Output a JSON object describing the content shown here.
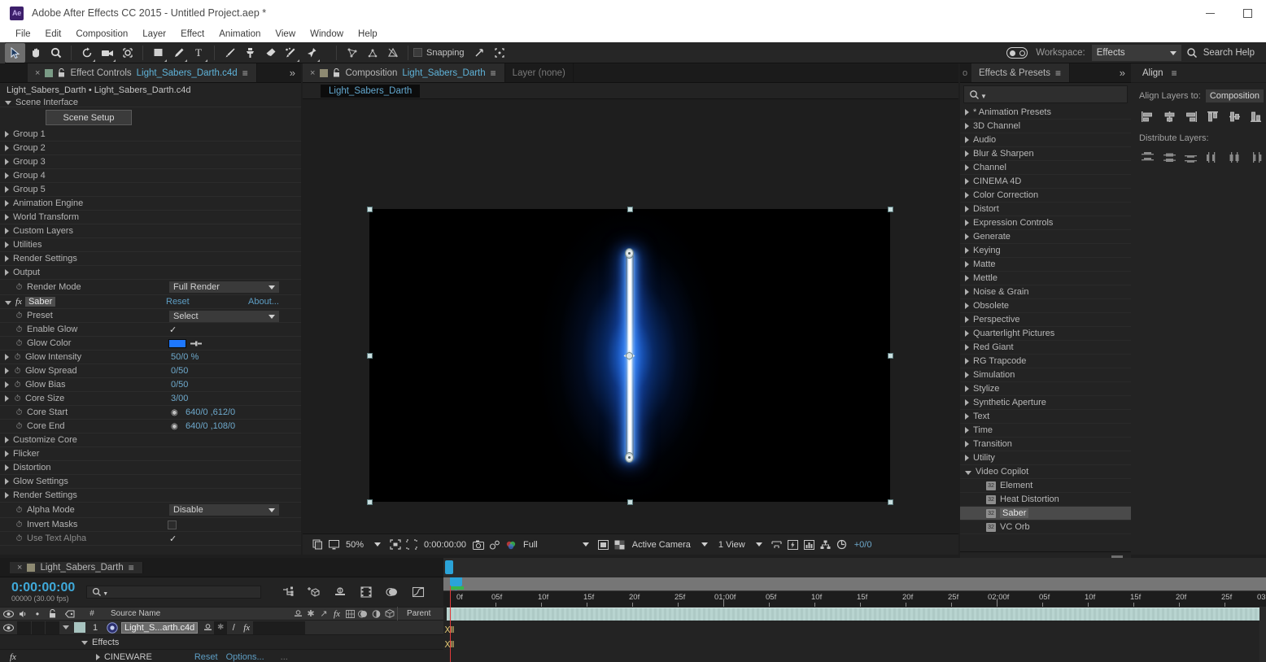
{
  "window": {
    "app_icon_text": "Ae",
    "title": "Adobe After Effects CC 2015 - Untitled Project.aep *",
    "minimize_label": "Minimize",
    "maximize_label": "Maximize"
  },
  "menubar": {
    "items": [
      "File",
      "Edit",
      "Composition",
      "Layer",
      "Effect",
      "Animation",
      "View",
      "Window",
      "Help"
    ]
  },
  "toolbar": {
    "snapping_label": "Snapping",
    "workspace_label": "Workspace:",
    "workspace_value": "Effects",
    "search_help": "Search Help",
    "tools": [
      "selection-tool",
      "hand-tool",
      "zoom-tool",
      "rotation-tool",
      "camera-tool",
      "pan-behind-tool",
      "shape-tool",
      "pen-tool",
      "type-tool",
      "brush-tool",
      "clone-stamp-tool",
      "eraser-tool",
      "roto-brush-tool",
      "puppet-pin-tool"
    ]
  },
  "effect_controls": {
    "tab_title": "Effect Controls",
    "tab_comp_name": "Light_Sabers_Darth.c4d",
    "close_label": "×",
    "menu_label": "≡",
    "chevron_label": "»",
    "breadcrumb": "Light_Sabers_Darth • Light_Sabers_Darth.c4d",
    "scene_setup_button": "Scene Setup",
    "rows": [
      {
        "label": "Scene Interface",
        "type": "group-open"
      },
      {
        "label": "Scene Setup",
        "type": "button"
      },
      {
        "label": "Group 1",
        "type": "group"
      },
      {
        "label": "Group 2",
        "type": "group"
      },
      {
        "label": "Group 3",
        "type": "group"
      },
      {
        "label": "Group 4",
        "type": "group"
      },
      {
        "label": "Group 5",
        "type": "group"
      },
      {
        "label": "Animation Engine",
        "type": "group"
      },
      {
        "label": "World Transform",
        "type": "group"
      },
      {
        "label": "Custom Layers",
        "type": "group"
      },
      {
        "label": "Utilities",
        "type": "group"
      },
      {
        "label": "Render Settings",
        "type": "group"
      },
      {
        "label": "Output",
        "type": "group"
      },
      {
        "label": "Render Mode",
        "type": "dropdown",
        "value": "Full Render"
      }
    ],
    "saber": {
      "name": "Saber",
      "reset_label": "Reset",
      "about_label": "About...",
      "params": [
        {
          "label": "Preset",
          "type": "dropdown",
          "value": "Select"
        },
        {
          "label": "Enable Glow",
          "type": "checkbox",
          "value": "✓"
        },
        {
          "label": "Glow Color",
          "type": "color",
          "value": "#1e78ff"
        },
        {
          "label": "Glow Intensity",
          "type": "value",
          "value": "50/0 %"
        },
        {
          "label": "Glow Spread",
          "type": "value",
          "value": "0/50"
        },
        {
          "label": "Glow Bias",
          "type": "value",
          "value": "0/50"
        },
        {
          "label": "Core Size",
          "type": "value",
          "value": "3/00"
        },
        {
          "label": "Core Start",
          "type": "point",
          "value": "640/0 ,612/0"
        },
        {
          "label": "Core End",
          "type": "point",
          "value": "640/0 ,108/0"
        },
        {
          "label": "Customize Core",
          "type": "group"
        },
        {
          "label": "Flicker",
          "type": "group"
        },
        {
          "label": "Distortion",
          "type": "group"
        },
        {
          "label": "Glow Settings",
          "type": "group"
        },
        {
          "label": "Render Settings",
          "type": "group"
        },
        {
          "label": "Alpha Mode",
          "type": "dropdown",
          "value": "Disable"
        },
        {
          "label": "Invert Masks",
          "type": "checkbox-empty",
          "value": ""
        },
        {
          "label": "Use Text Alpha",
          "type": "checkbox",
          "value": "✓",
          "dim": true
        }
      ]
    }
  },
  "composition": {
    "tab_title": "Composition",
    "tab_comp_name": "Light_Sabers_Darth",
    "layer_tab": "Layer (none)",
    "sub_tab": "Light_Sabers_Darth",
    "bottom_bar": {
      "zoom": "50%",
      "timecode": "0:00:00:00",
      "resolution": "Full",
      "camera": "Active Camera",
      "views": "1 View",
      "pixel_counter": "+0/0"
    }
  },
  "effects_presets": {
    "tab_title": "Effects & Presets",
    "search_placeholder": "",
    "categories": [
      {
        "label": "* Animation Presets",
        "open": false
      },
      {
        "label": "3D Channel",
        "open": false
      },
      {
        "label": "Audio",
        "open": false
      },
      {
        "label": "Blur & Sharpen",
        "open": false
      },
      {
        "label": "Channel",
        "open": false
      },
      {
        "label": "CINEMA 4D",
        "open": false
      },
      {
        "label": "Color Correction",
        "open": false
      },
      {
        "label": "Distort",
        "open": false
      },
      {
        "label": "Expression Controls",
        "open": false
      },
      {
        "label": "Generate",
        "open": false
      },
      {
        "label": "Keying",
        "open": false
      },
      {
        "label": "Matte",
        "open": false
      },
      {
        "label": "Mettle",
        "open": false
      },
      {
        "label": "Noise & Grain",
        "open": false
      },
      {
        "label": "Obsolete",
        "open": false
      },
      {
        "label": "Perspective",
        "open": false
      },
      {
        "label": "Quarterlight Pictures",
        "open": false
      },
      {
        "label": "Red Giant",
        "open": false
      },
      {
        "label": "RG Trapcode",
        "open": false
      },
      {
        "label": "Simulation",
        "open": false
      },
      {
        "label": "Stylize",
        "open": false
      },
      {
        "label": "Synthetic Aperture",
        "open": false
      },
      {
        "label": "Text",
        "open": false
      },
      {
        "label": "Time",
        "open": false
      },
      {
        "label": "Transition",
        "open": false
      },
      {
        "label": "Utility",
        "open": false
      },
      {
        "label": "Video Copilot",
        "open": true
      }
    ],
    "video_copilot_effects": [
      {
        "label": "Element",
        "badge": "32",
        "selected": false
      },
      {
        "label": "Heat Distortion",
        "badge": "32",
        "selected": false
      },
      {
        "label": "Saber",
        "badge": "32",
        "selected": true
      },
      {
        "label": "VC Orb",
        "badge": "32",
        "selected": false
      }
    ]
  },
  "align": {
    "tab_title": "Align",
    "menu_label": "≡",
    "align_layers_label": "Align Layers to:",
    "align_target": "Composition",
    "distribute_label": "Distribute Layers:",
    "align_buttons": [
      "align-left-icon",
      "align-horizontal-center-icon",
      "align-right-icon",
      "align-top-icon",
      "align-vertical-center-icon",
      "align-bottom-icon"
    ],
    "distribute_buttons": [
      "distribute-top-icon",
      "distribute-vertical-center-icon",
      "distribute-bottom-icon",
      "distribute-left-icon",
      "distribute-horizontal-center-icon",
      "distribute-right-icon"
    ]
  },
  "timeline": {
    "tab_title": "Light_Sabers_Darth",
    "current_time": "0:00:00:00",
    "frame_info": "00000 (30.00 fps)",
    "search_placeholder": "",
    "columns": [
      "#",
      "Source Name",
      "Parent"
    ],
    "source_name_header": "Source Name",
    "parent_header": "Parent",
    "layers": [
      {
        "index": "1",
        "name": "Light_S...arth.c4d",
        "type": "layer"
      },
      {
        "name": "Effects",
        "type": "group"
      },
      {
        "name": "CINEWARE",
        "type": "effect",
        "reset": "Reset",
        "options": "Options...",
        "more": "..."
      }
    ],
    "ruler_labels": [
      "0f",
      "05f",
      "10f",
      "15f",
      "20f",
      "25f",
      "01:00f",
      "05f",
      "10f",
      "15f",
      "20f",
      "25f",
      "02:00f",
      "05f",
      "10f",
      "15f",
      "20f",
      "25f",
      "03:"
    ]
  },
  "colors": {
    "accent_blue": "#3fa9d9",
    "link_blue": "#5e9ec4",
    "glow_color": "#1e78ff",
    "playhead_red": "#e23b3b",
    "layer_bar": "#b8d4d0",
    "panel_bg": "#232323"
  }
}
